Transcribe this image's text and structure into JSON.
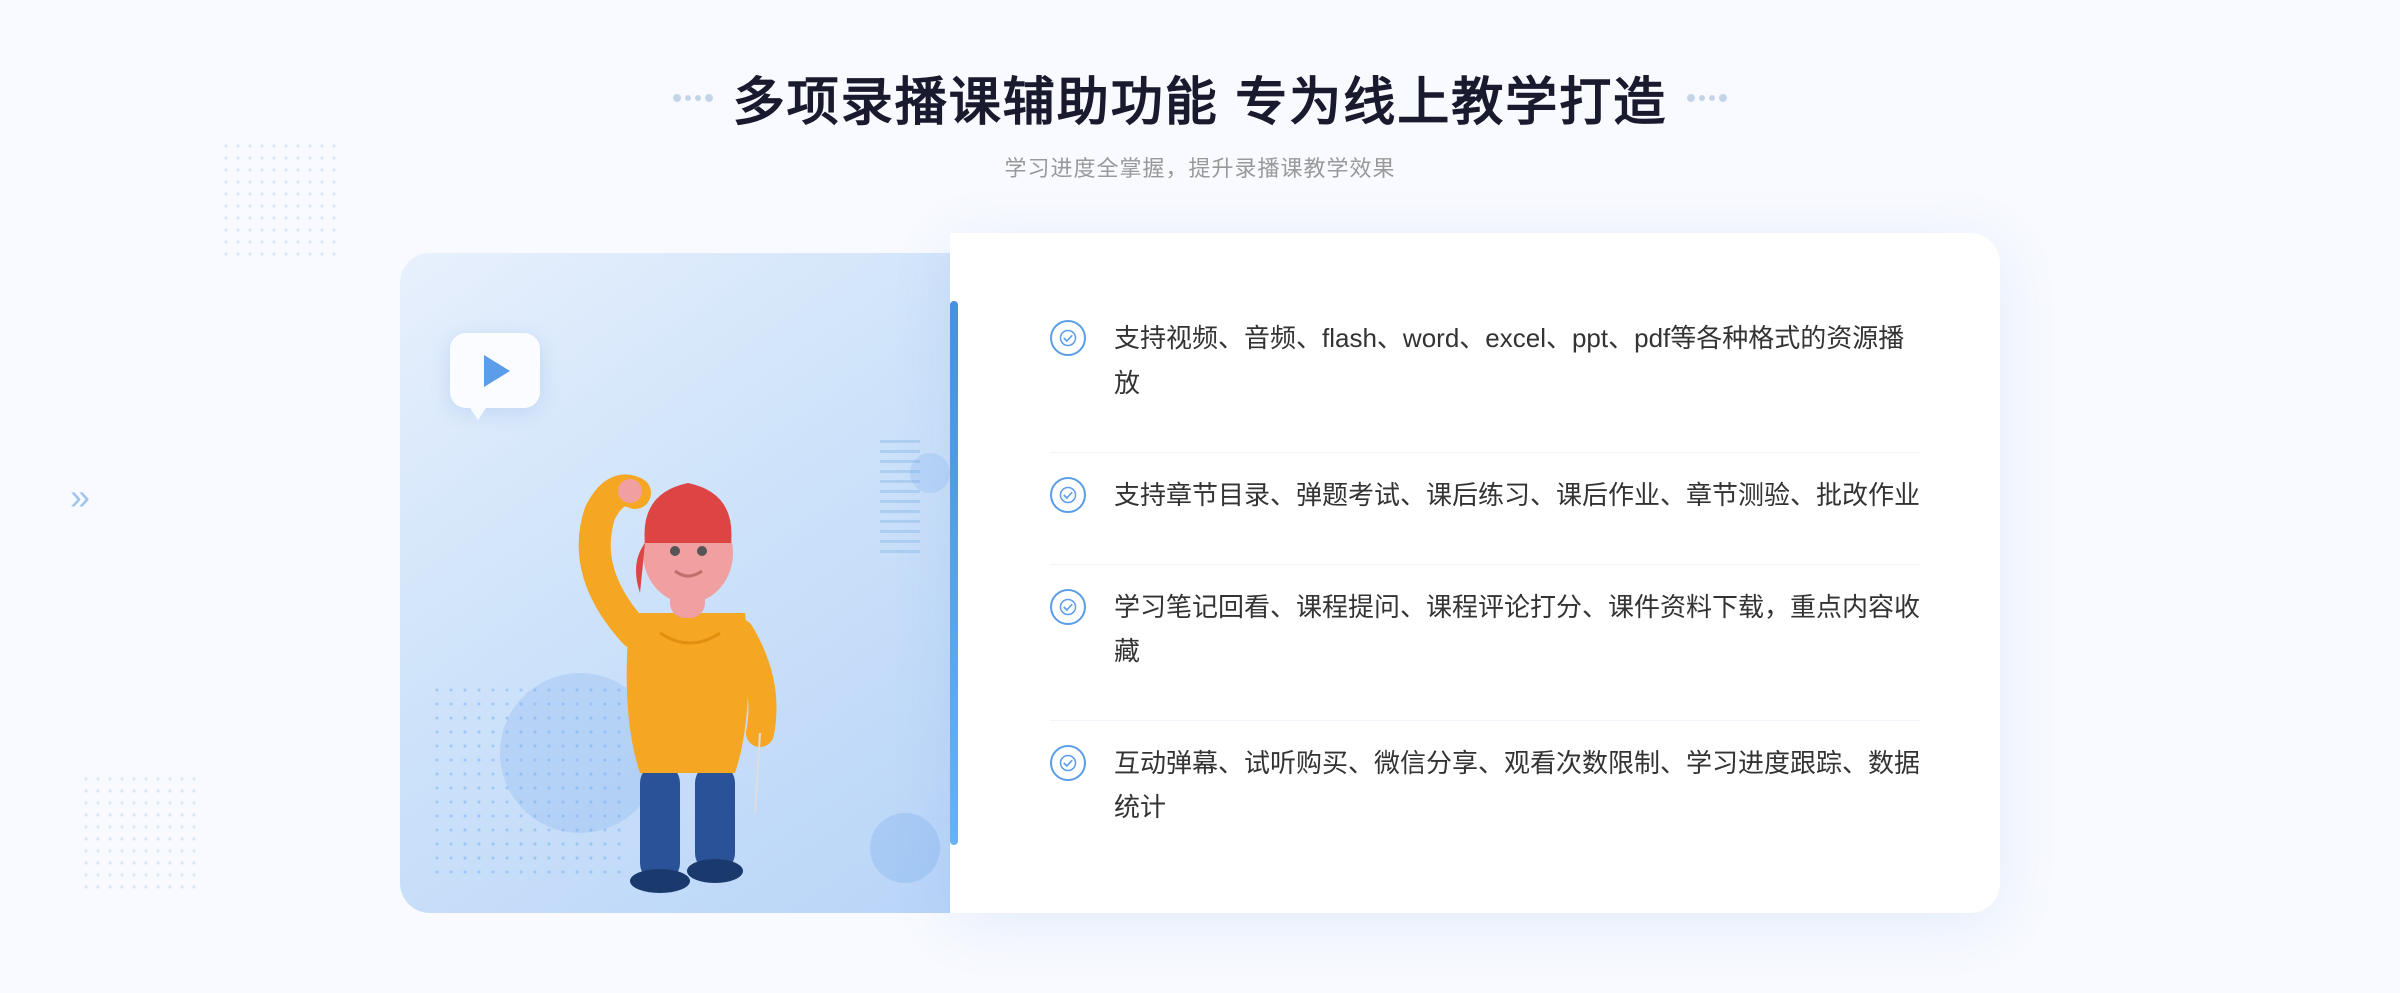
{
  "header": {
    "main_title": "多项录播课辅助功能 专为线上教学打造",
    "sub_title": "学习进度全掌握，提升录播课教学效果"
  },
  "decoration": {
    "chevron_symbol": "»"
  },
  "features": [
    {
      "id": "feature-1",
      "text": "支持视频、音频、flash、word、excel、ppt、pdf等各种格式的资源播放"
    },
    {
      "id": "feature-2",
      "text": "支持章节目录、弹题考试、课后练习、课后作业、章节测验、批改作业"
    },
    {
      "id": "feature-3",
      "text": "学习笔记回看、课程提问、课程评论打分、课件资料下载，重点内容收藏"
    },
    {
      "id": "feature-4",
      "text": "互动弹幕、试听购买、微信分享、观看次数限制、学习进度跟踪、数据统计"
    }
  ],
  "colors": {
    "accent_blue": "#4a8fe0",
    "light_blue": "#5b9de8",
    "title_color": "#1a1a2e",
    "text_color": "#333333",
    "sub_text_color": "#999999"
  }
}
